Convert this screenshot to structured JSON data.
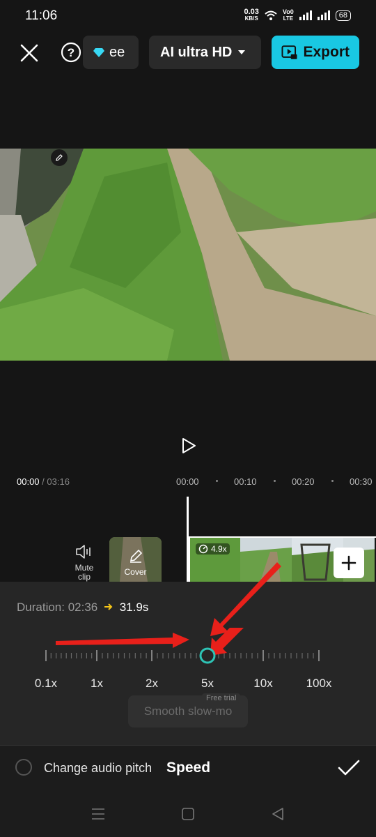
{
  "status_bar": {
    "time": "11:06",
    "net_speed": "0.03",
    "net_unit": "KB/S",
    "carrier_top": "Vo0",
    "carrier_bottom": "LTE",
    "battery": "68"
  },
  "top_bar": {
    "pro_label": "ee",
    "quality_label": "AI ultra HD",
    "export_label": "Export",
    "colors": {
      "export_bg": "#19c8e3",
      "pro_diamond": "#38d9f5"
    }
  },
  "player": {
    "play_icon": "play-icon"
  },
  "timeline": {
    "current_time": "00:00",
    "total_time": "/ 03:16",
    "ruler": [
      "00:00",
      "00:10",
      "00:20",
      "00:30"
    ],
    "mute_label": "Mute clip",
    "cover_label": "Cover",
    "clip_speed_badge": "4.9x"
  },
  "speed_panel": {
    "duration_label": "Duration:",
    "duration_original": "02:36",
    "duration_new": "31.9s",
    "slider_labels": [
      "0.1x",
      "1x",
      "2x",
      "5x",
      "10x",
      "100x"
    ],
    "slider_value": "4.9x",
    "free_trial_label": "Free trial",
    "smooth_slowmo_label": "Smooth slow-mo",
    "colors": {
      "knob": "#2ec4b6",
      "arrow": "#e8201a",
      "duration_arrow": "#f5c518"
    }
  },
  "bottom": {
    "audio_pitch_label": "Change audio pitch",
    "tool_title": "Speed"
  }
}
